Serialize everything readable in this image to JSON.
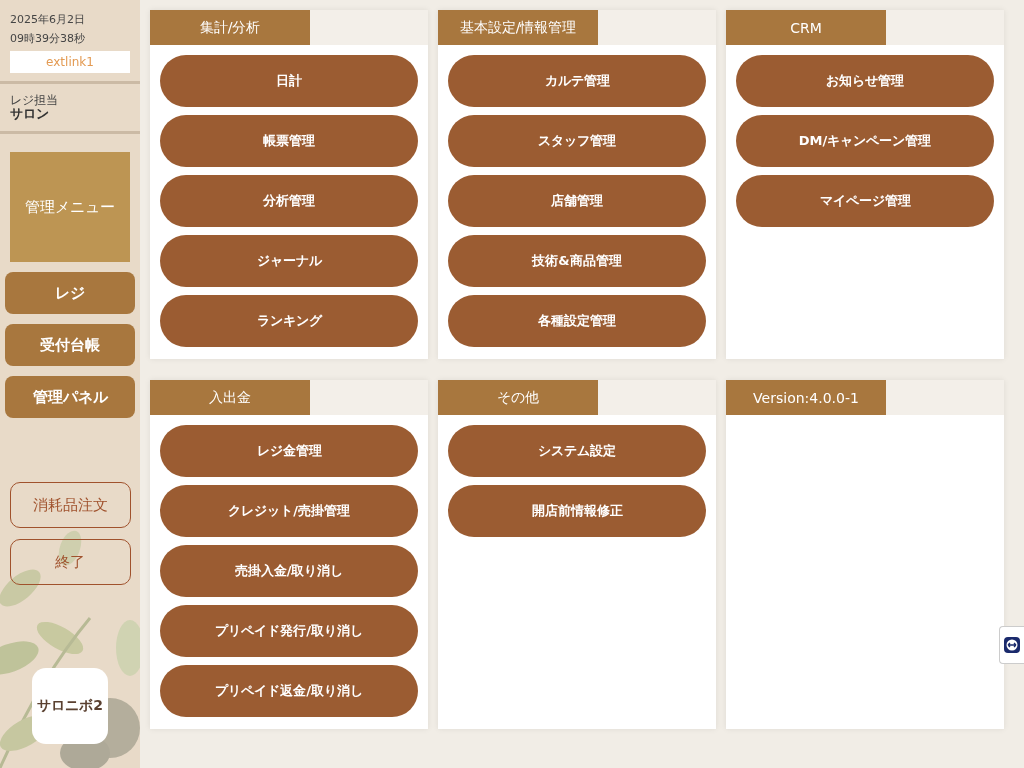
{
  "clock": {
    "date": "2025年6月2日",
    "time": "09時39分38秒"
  },
  "link": "extlink1",
  "cashier": {
    "label": "レジ担当",
    "name": "サロン"
  },
  "menu_title": "管理メニュー",
  "nav": [
    "レジ",
    "受付台帳",
    "管理パネル"
  ],
  "outline_buttons": [
    "消耗品注文",
    "終了"
  ],
  "logo": "サロニボ2",
  "panels": [
    {
      "title": "集計/分析",
      "buttons": [
        "日計",
        "帳票管理",
        "分析管理",
        "ジャーナル",
        "ランキング"
      ]
    },
    {
      "title": "基本設定/情報管理",
      "buttons": [
        "カルテ管理",
        "スタッフ管理",
        "店舗管理",
        "技術&商品管理",
        "各種設定管理"
      ]
    },
    {
      "title": "CRM",
      "buttons": [
        "お知らせ管理",
        "DM/キャンペーン管理",
        "マイページ管理"
      ]
    },
    {
      "title": "入出金",
      "buttons": [
        "レジ金管理",
        "クレジット/売掛管理",
        "売掛入金/取り消し",
        "プリペイド発行/取り消し",
        "プリペイド返金/取り消し"
      ]
    },
    {
      "title": "その他",
      "buttons": [
        "システム設定",
        "開店前情報修正"
      ]
    },
    {
      "title": "Version:4.0.0-1"
    }
  ]
}
